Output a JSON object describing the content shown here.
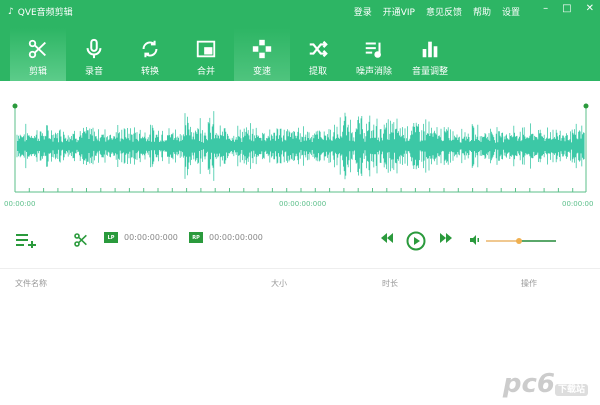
{
  "app": {
    "title": "QVE音频剪辑",
    "icon": "music-note-icon"
  },
  "menu": [
    "登录",
    "开通VIP",
    "意见反馈",
    "帮助",
    "设置"
  ],
  "window_controls": {
    "minimize": "–",
    "maximize": "□",
    "close": "✕"
  },
  "tabs": [
    {
      "label": "剪辑",
      "icon": "scissors-icon",
      "active": true
    },
    {
      "label": "录音",
      "icon": "microphone-icon"
    },
    {
      "label": "转换",
      "icon": "refresh-icon"
    },
    {
      "label": "合并",
      "icon": "merge-icon"
    },
    {
      "label": "变速",
      "icon": "speed-icon",
      "highlighted": true
    },
    {
      "label": "提取",
      "icon": "shuffle-icon"
    },
    {
      "label": "噪声消除",
      "icon": "noise-icon"
    },
    {
      "label": "音量调整",
      "icon": "volume-bars-icon"
    }
  ],
  "timeline": {
    "start": "00:00:00",
    "middle": "00:00:00:000",
    "end": "00:00:00"
  },
  "controls": {
    "lp_label": "LP",
    "lp_time": "00:00:00:000",
    "rp_label": "RP",
    "rp_time": "00:00:00:000",
    "volume": 0.47
  },
  "table": {
    "columns": [
      "文件名称",
      "大小",
      "时长",
      "操作"
    ]
  },
  "colors": {
    "brand": "#2db564",
    "wave": "#3cc8a6",
    "volume": "#f0b050"
  },
  "watermark": {
    "text": "pc6",
    "sub": "下载站"
  }
}
